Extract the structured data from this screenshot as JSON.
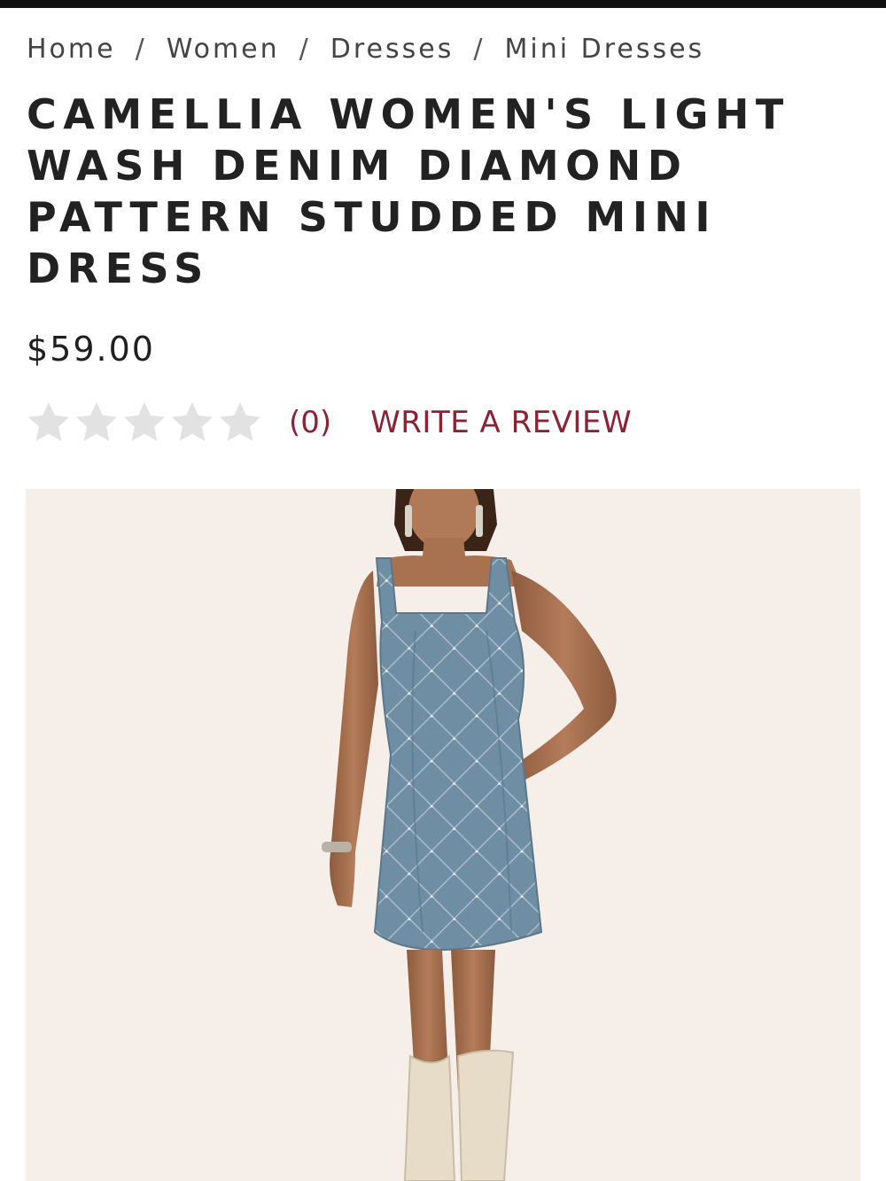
{
  "breadcrumb": {
    "items": [
      "Home",
      "Women",
      "Dresses",
      "Mini Dresses"
    ],
    "separator": "/"
  },
  "product": {
    "title": "CAMELLIA WOMEN'S LIGHT WASH DENIM DIAMOND PATTERN STUDDED MINI DRESS",
    "price": "$59.00"
  },
  "rating": {
    "stars_filled": 0,
    "stars_total": 5,
    "review_count": "(0)",
    "write_review_label": "WRITE A REVIEW",
    "star_color_empty": "#e2e2e2"
  },
  "colors": {
    "accent": "#8a2336",
    "top_bar": "#111111",
    "image_background": "#f5eee9",
    "denim": "#6f8ea3"
  }
}
